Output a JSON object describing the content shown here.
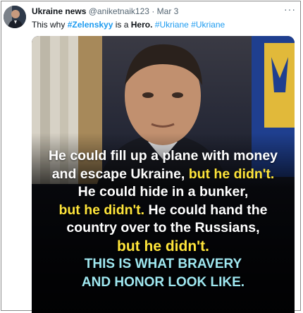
{
  "tweet": {
    "author_name": "Ukraine news",
    "handle": "@aniketnaik123",
    "separator": "·",
    "date": "Mar 3",
    "text_prefix": "This why ",
    "hashtag_1": "#Zelenskyy",
    "text_mid": " is a ",
    "text_hero": "Hero.",
    "hashtag_2": "#Ukriane",
    "hashtag_3": "#Ukriane",
    "more_icon": "more-horizontal-icon"
  },
  "image_caption": {
    "line1": "He could fill up a plane with money",
    "line2a": "and escape Ukraine, ",
    "line2b": "but he didn't.",
    "line3": "He could hide in a bunker,",
    "line4a": "but he didn't.",
    "line4b": " He could hand the",
    "line5": "country over to the Russians,",
    "line6": "but he didn't.",
    "line7": "THIS IS WHAT BRAVERY",
    "line8": "AND HONOR LOOK LIKE."
  },
  "colors": {
    "link": "#1d9bf0",
    "caption_yellow": "#ffe53a",
    "caption_cyan": "#9fe7f0"
  }
}
